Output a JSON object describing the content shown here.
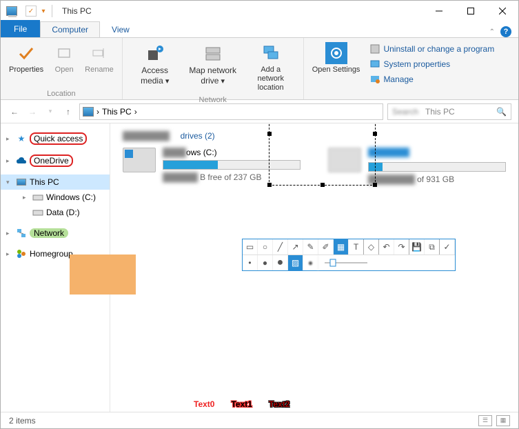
{
  "titlebar": {
    "title": "This PC"
  },
  "tabs": {
    "file": "File",
    "computer": "Computer",
    "view": "View"
  },
  "ribbon": {
    "properties": "Properties",
    "open": "Open",
    "rename": "Rename",
    "access_media": "Access media",
    "map_drive": "Map network drive",
    "add_loc": "Add a network location",
    "open_settings": "Open Settings",
    "uninstall": "Uninstall or change a program",
    "sysprops": "System properties",
    "manage": "Manage",
    "group_location": "Location",
    "group_network": "Network"
  },
  "nav": {
    "breadcrumb": "This PC",
    "search_placeholder": "This PC"
  },
  "sidebar": {
    "quick_access": "Quick access",
    "onedrive": "OneDrive",
    "this_pc": "This PC",
    "windows_c": "Windows (C:)",
    "data_d": "Data (D:)",
    "network": "Network",
    "homegroup": "Homegroup"
  },
  "content": {
    "group_header": "drives (2)",
    "drive_c": {
      "name": "ows (C:)",
      "sub": "B free of 237 GB",
      "fill": 40
    },
    "drive_d": {
      "sub": "of 931 GB",
      "fill": 10
    }
  },
  "status": {
    "count": "2 items"
  },
  "annotations": {
    "t0": "Text0",
    "t1": "Text1",
    "t2": "Text2"
  }
}
